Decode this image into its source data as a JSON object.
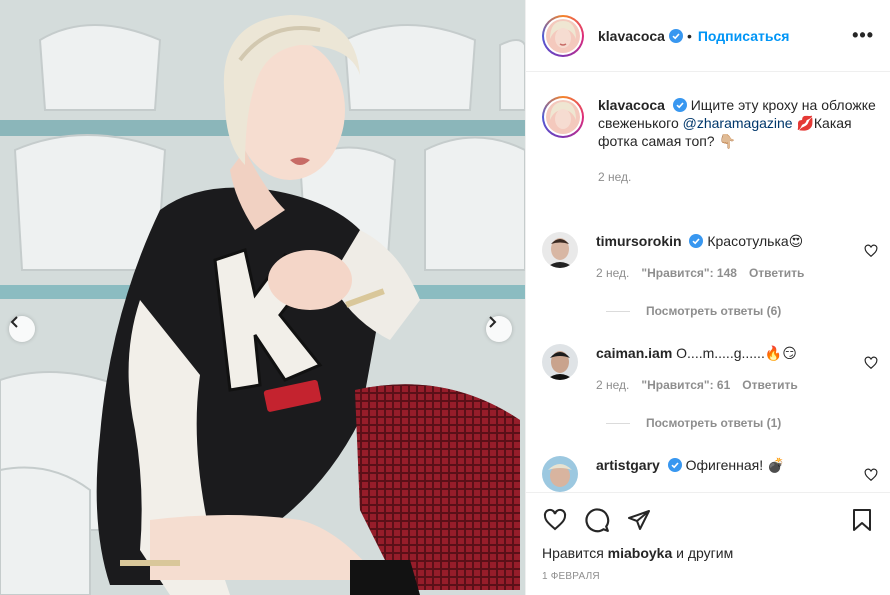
{
  "post": {
    "author": "klavacoca",
    "follow_label": "Подписаться",
    "dot": "•",
    "more": "•••",
    "caption_text": "Ищите эту кроху на обложке свеженького",
    "caption_mention": "@zharamagazine",
    "caption_tail": "💋Какая фотка самая топ? 👇🏼",
    "caption_time": "2 нед.",
    "likes_prefix": "Нравится",
    "likes_user": "miaboyka",
    "likes_suffix": "и другим",
    "date": "1 ФЕВРАЛЯ"
  },
  "comments": [
    {
      "user": "timursorokin",
      "text": "Красотулька😍",
      "time": "2 нед.",
      "likes": "\"Нравится\": 148",
      "reply": "Ответить",
      "replies": "Посмотреть ответы (6)"
    },
    {
      "user": "caiman.iam",
      "text": "О....m.....g......🔥😏",
      "time": "2 нед.",
      "likes": "\"Нравится\": 61",
      "reply": "Ответить",
      "replies": "Посмотреть ответы (1)"
    },
    {
      "user": "artistgary",
      "text": "Офигенная! 💣",
      "time": "",
      "likes": "",
      "reply": "",
      "replies": ""
    }
  ],
  "colors": {
    "accent": "#0095f6",
    "verified": "#3897f0",
    "muted": "#8e8e8e"
  },
  "icons": [
    "chevron-left-icon",
    "chevron-right-icon",
    "verified-icon",
    "heart-icon",
    "comment-icon",
    "share-icon",
    "bookmark-icon",
    "more-icon"
  ]
}
